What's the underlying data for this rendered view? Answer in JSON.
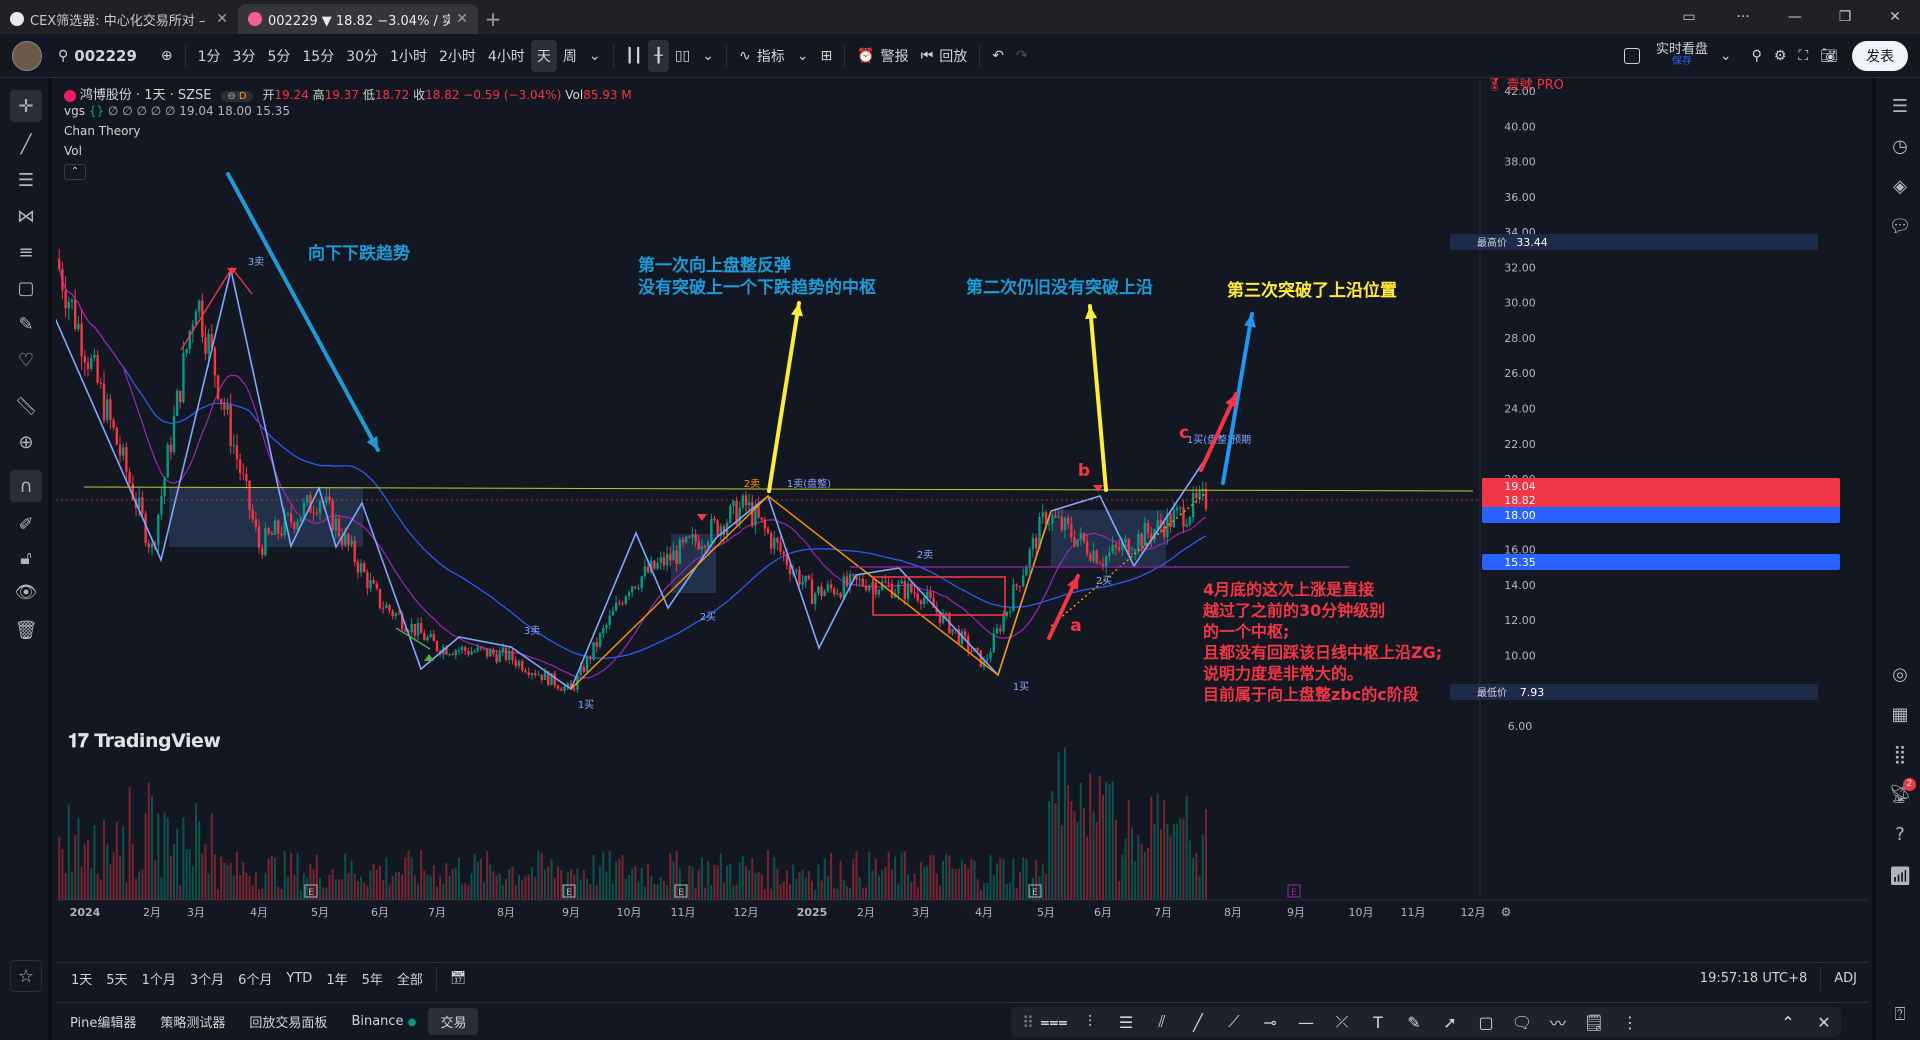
{
  "browser": {
    "tabs": [
      {
        "title": "CEX筛选器: 中心化交易所对 –"
      },
      {
        "title": "002229 ▼ 18.82 −3.04% / 实时"
      }
    ]
  },
  "toolbar": {
    "symbol": "002229",
    "intervals": [
      "1分",
      "3分",
      "5分",
      "15分",
      "30分",
      "1小时",
      "2小时",
      "4小时",
      "天",
      "周"
    ],
    "selected_interval": "天",
    "indicators_label": "指标",
    "alert_label": "警报",
    "replay_label": "回放",
    "layout_label": "实时看盘",
    "layout_sub": "保存",
    "publish_label": "发表"
  },
  "legend": {
    "title": "鸿博股份 · 1天 · SZSE",
    "open_label": "开",
    "open": "19.24",
    "high_label": "高",
    "high": "19.37",
    "low_label": "低",
    "low": "18.72",
    "close_label": "收",
    "close": "18.82",
    "change": "−0.59 (−3.04%)",
    "vol_label": "Vol",
    "vol": "85.93 M",
    "ind1_name": "vgs",
    "ind1_vals": "∅ ∅ ∅ ∅ ∅  19.04  18.00  15.35",
    "ind2_name": "Chan Theory",
    "ind3_name": "Vol",
    "pro_badge": "壹號 PRO",
    "watermark": "TradingView"
  },
  "annotations": {
    "t1": "向下下跌趋势",
    "t2_line1": "第一次向上盘整反弹",
    "t2_line2": "没有突破上一个下跌趋势的中枢",
    "t3": "第二次仍旧没有突破上沿",
    "t4": "第三次突破了上沿位置",
    "letter_a": "a",
    "letter_b": "b",
    "letter_c": "c",
    "note_lines": [
      "4月底的这次上涨是直接",
      "越过了之前的30分钟级别",
      "的一个中枢;",
      "且都没有回踩该日线中枢上沿ZG;",
      "说明力度是非常大的。",
      "目前属于向上盘整zbc的c阶段"
    ],
    "chan_labels": [
      "3卖",
      "2卖",
      "1卖(盘整)",
      "2卖",
      "3卖",
      "2买",
      "2买",
      "1买",
      "1买",
      "1买(盘整)预期"
    ]
  },
  "price_axis": {
    "ticks": [
      "42.00",
      "40.00",
      "38.00",
      "36.00",
      "34.00",
      "32.00",
      "30.00",
      "28.00",
      "26.00",
      "24.00",
      "22.00",
      "20.00",
      "18.00",
      "16.00",
      "14.00",
      "12.00",
      "10.00",
      "8.00",
      "6.00"
    ],
    "badges": [
      {
        "label": "最高价",
        "value": "33.44",
        "color": "#1e2a4a"
      },
      {
        "label": "",
        "value": "19.04",
        "color": "#f23645"
      },
      {
        "label": "",
        "value": "18.82",
        "color": "#f23645"
      },
      {
        "label": "",
        "value": "18.00",
        "color": "#2962ff"
      },
      {
        "label": "",
        "value": "15.35",
        "color": "#2962ff"
      },
      {
        "label": "最低价",
        "value": "7.93",
        "color": "#1e2a4a"
      }
    ]
  },
  "time_axis": [
    "2024",
    "2月",
    "3月",
    "4月",
    "5月",
    "6月",
    "7月",
    "8月",
    "9月",
    "10月",
    "11月",
    "12月",
    "2025",
    "2月",
    "3月",
    "4月",
    "5月",
    "6月",
    "7月",
    "8月",
    "9月",
    "10月",
    "11月",
    "12月"
  ],
  "range_bar": {
    "ranges": [
      "1天",
      "5天",
      "1个月",
      "3个月",
      "6个月",
      "YTD",
      "1年",
      "5年",
      "全部"
    ],
    "clock": "19:57:18 UTC+8",
    "adj": "ADJ"
  },
  "panel_bar": {
    "tabs": [
      "Pine编辑器",
      "策略测试器",
      "回放交易面板",
      "Binance",
      "交易"
    ]
  },
  "chart_data": {
    "type": "candlestick",
    "title": "鸿博股份 · 1天 · SZSE",
    "ylim": [
      6,
      42
    ],
    "x": [
      "2024-01",
      "2024-02",
      "2024-03",
      "2024-04",
      "2024-05",
      "2024-06",
      "2024-07",
      "2024-08",
      "2024-09",
      "2024-10",
      "2024-11",
      "2024-12",
      "2025-01",
      "2025-02",
      "2025-03",
      "2025-04",
      "2025-05",
      "2025-06",
      "2025-07"
    ],
    "close_path": [
      32.5,
      16.0,
      30.5,
      16.2,
      19.0,
      13.0,
      10.5,
      10.0,
      8.0,
      14.0,
      16.0,
      18.5,
      13.5,
      14.2,
      13.5,
      9.5,
      18.0,
      15.5,
      18.82
    ],
    "last_close": 18.82,
    "high": 33.44,
    "low": 7.93
  },
  "colors": {
    "up": "#089981",
    "down": "#f23645",
    "bg": "#131722",
    "annot_blue": "#1e9bd7",
    "annot_yellow": "#ffeb3b",
    "annot_red": "#f23645"
  }
}
